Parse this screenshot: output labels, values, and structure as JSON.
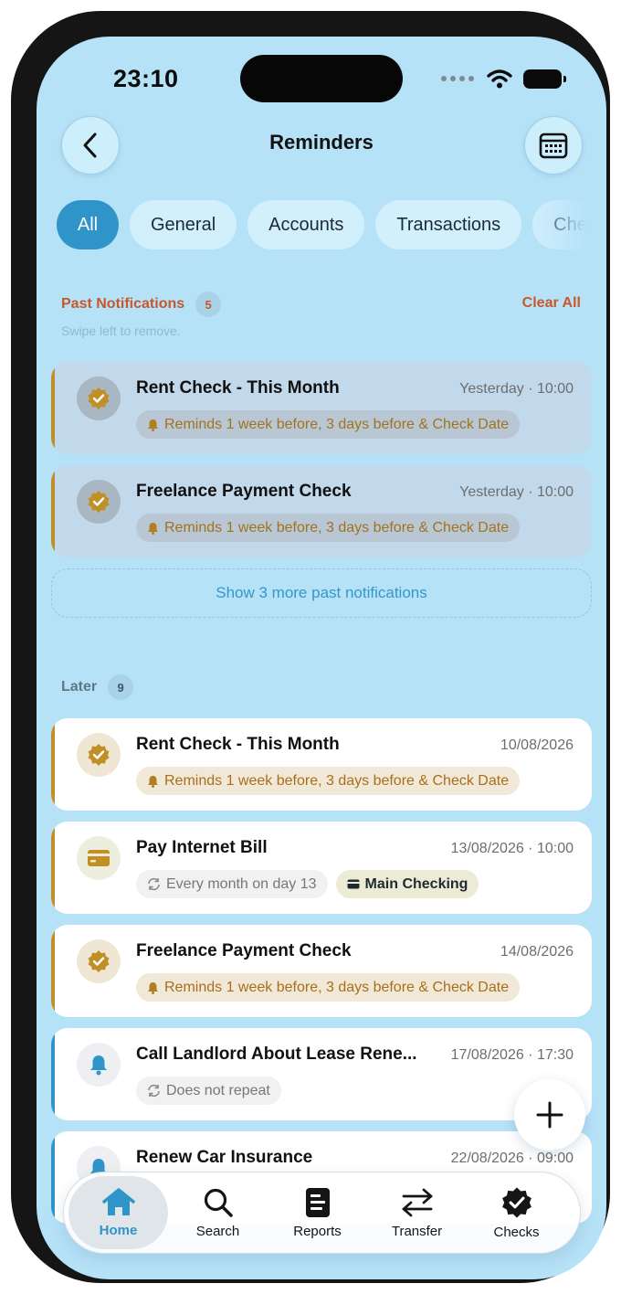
{
  "status": {
    "time": "23:10"
  },
  "header": {
    "title": "Reminders",
    "back_icon": "chevron-left-icon",
    "calendar_icon": "calendar-icon"
  },
  "filters": [
    "All",
    "General",
    "Accounts",
    "Transactions",
    "Checks"
  ],
  "past": {
    "label": "Past Notifications",
    "count": "5",
    "clear_all": "Clear All",
    "hint": "Swipe left to remove.",
    "items": [
      {
        "title": "Rent Check - This Month",
        "date": "Yesterday · 10:00",
        "tag": "Reminds 1 week before, 3 days before & Check Date",
        "icon": "check-badge-icon"
      },
      {
        "title": "Freelance Payment Check",
        "date": "Yesterday · 10:00",
        "tag": "Reminds 1 week before, 3 days before & Check Date",
        "icon": "check-badge-icon"
      }
    ],
    "show_more": "Show 3 more past notifications"
  },
  "later": {
    "label": "Later",
    "count": "9",
    "items": [
      {
        "title": "Rent Check - This Month",
        "date": "10/08/2026",
        "tags": [
          "Reminds 1 week before, 3 days before & Check Date"
        ],
        "icon": "check-badge-icon"
      },
      {
        "title": "Pay Internet Bill",
        "date": "13/08/2026 · 10:00",
        "tags": [
          "Every month on day 13",
          "Main Checking"
        ],
        "icon": "credit-card-icon"
      },
      {
        "title": "Freelance Payment Check",
        "date": "14/08/2026",
        "tags": [
          "Reminds 1 week before, 3 days before & Check Date"
        ],
        "icon": "check-badge-icon"
      },
      {
        "title": "Call Landlord About Lease Rene...",
        "date": "17/08/2026 · 17:30",
        "tags": [
          "Does not repeat"
        ],
        "icon": "bell-icon"
      },
      {
        "title": "Renew Car Insurance",
        "date": "22/08/2026 · 09:00",
        "tags": [],
        "icon": "bell-icon"
      }
    ]
  },
  "tabs": [
    "Home",
    "Search",
    "Reports",
    "Transfer",
    "Checks"
  ],
  "colors": {
    "background": "#b6e2f8",
    "accent": "#2f95c8",
    "warning": "#c8582b",
    "gold": "#c08f27"
  }
}
